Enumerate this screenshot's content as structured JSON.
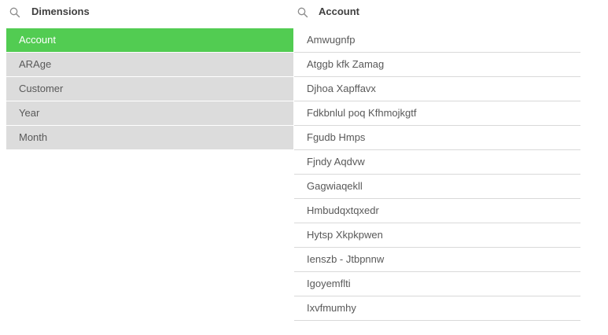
{
  "dimensions_panel": {
    "title": "Dimensions",
    "search_icon": "search-icon",
    "items": [
      {
        "label": "Account",
        "state": "selected"
      },
      {
        "label": "ARAge",
        "state": "available"
      },
      {
        "label": "Customer",
        "state": "available"
      },
      {
        "label": "Year",
        "state": "available"
      },
      {
        "label": "Month",
        "state": "available"
      }
    ]
  },
  "account_panel": {
    "title": "Account",
    "search_icon": "search-icon",
    "items": [
      {
        "label": "Amwugnfp"
      },
      {
        "label": "Atggb kfk Zamag"
      },
      {
        "label": "Djhoa Xapffavx"
      },
      {
        "label": "Fdkbnlul poq Kfhmojkgtf"
      },
      {
        "label": "Fgudb Hmps"
      },
      {
        "label": "Fjndy Aqdvw"
      },
      {
        "label": "Gagwiaqekll"
      },
      {
        "label": "Hmbudqxtqxedr"
      },
      {
        "label": "Hytsp Xkpkpwen"
      },
      {
        "label": "Ienszb - Jtbpnnw"
      },
      {
        "label": "Igoyemflti"
      },
      {
        "label": "Ixvfmumhy"
      }
    ]
  },
  "colors": {
    "selected": "#52cc52",
    "available": "#dcdcdc",
    "text": "#595959",
    "header_text": "#404040",
    "divider": "#d9d9d9"
  }
}
